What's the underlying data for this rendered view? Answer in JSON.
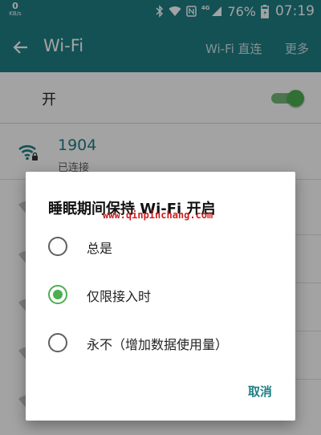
{
  "status_bar": {
    "speed_value": "0",
    "speed_unit": "KB/s",
    "network_type": "4G",
    "battery": "76%",
    "time": "07:19",
    "icons": [
      "bluetooth-icon",
      "wifi-icon",
      "nfc-icon",
      "signal-icon",
      "battery-charging-icon"
    ]
  },
  "app_bar": {
    "back_icon": "arrow-left-icon",
    "title": "Wi-Fi",
    "actions": {
      "wifi_direct": "Wi-Fi 直连",
      "more": "更多"
    }
  },
  "toggle": {
    "label": "开",
    "on": true,
    "color": "#4caf50"
  },
  "network": {
    "name": "1904",
    "status": "已连接",
    "icon": "wifi-lock-icon"
  },
  "dialog": {
    "title": "睡眠期间保持 Wi-Fi 开启",
    "watermark": "www.qinpinchang.com",
    "options": [
      {
        "label": "总是",
        "checked": false
      },
      {
        "label": "仅限接入时",
        "checked": true
      },
      {
        "label": "永不（增加数据使用量）",
        "checked": false
      }
    ],
    "cancel_label": "取消"
  },
  "colors": {
    "primary": "#1f7f86",
    "accent": "#4caf50",
    "watermark": "#d11c1c"
  }
}
